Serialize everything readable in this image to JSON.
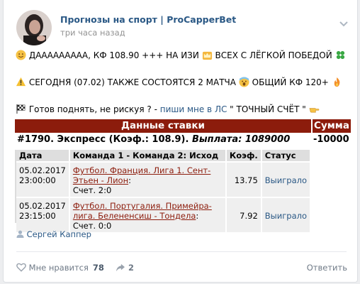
{
  "post": {
    "title": "Прогнозы на спорт | ProCapperBet",
    "time": "три часа назад",
    "line1": "ДААААААААА, КФ 108.90 +++ НА ИЗИ",
    "line1b": "ВСЕХ С ЛЁГКОЙ ПОБЕДОЙ",
    "line2": "СЕГОДНЯ (07.02) ТАКЖЕ СОСТОЯТСЯ 2 МАТЧА",
    "line2b": "ОБЩИЙ КФ 120+",
    "line3_pre": "Готов поднять, не рискуя ? - ",
    "line3_link": "пиши мне в ЛС",
    "line3_post": " \" ТОЧНЫЙ СЧЁТ \""
  },
  "bet": {
    "header_main": "Данные ставки",
    "header_sum": "Сумма",
    "summary": "#1790. Экспресс (Коэф.: 108.9). ",
    "payout": "Выплата: 1089000",
    "sum_value": "-10000",
    "columns": [
      "Дата",
      "Команда 1 - Команда 2: Исход",
      "Коэф.",
      "Статус"
    ],
    "rows": [
      {
        "date": "05.02.2017 23:00:00",
        "match": "Футбол. Франция. Лига 1. Сент-Этьен - Лион",
        "score": "Счет. 2:0",
        "coef": "13.75",
        "status": "Выиграло"
      },
      {
        "date": "05.02.2017 23:15:00",
        "match": "Футбол. Португалия. Примейра-лига. Белененсиш - Тондела",
        "score": "Счет. 0:0",
        "coef": "7.92",
        "status": "Выиграло"
      }
    ]
  },
  "footer": {
    "author": "Сергей Каппер",
    "like_label": "Мне нравится",
    "like_count": "78",
    "share_count": "2",
    "reply_label": "Ответить"
  },
  "colors": {
    "accent": "#2a5885",
    "bet_header": "#8c1c0c"
  },
  "icons": [
    "smile-icon",
    "crown-icon",
    "clover-icon",
    "warning-icon",
    "scream-icon",
    "fire-icon",
    "checkered-flag-icon",
    "pointing-hand-icon",
    "person-icon",
    "heart-icon",
    "share-icon",
    "more-icon"
  ]
}
